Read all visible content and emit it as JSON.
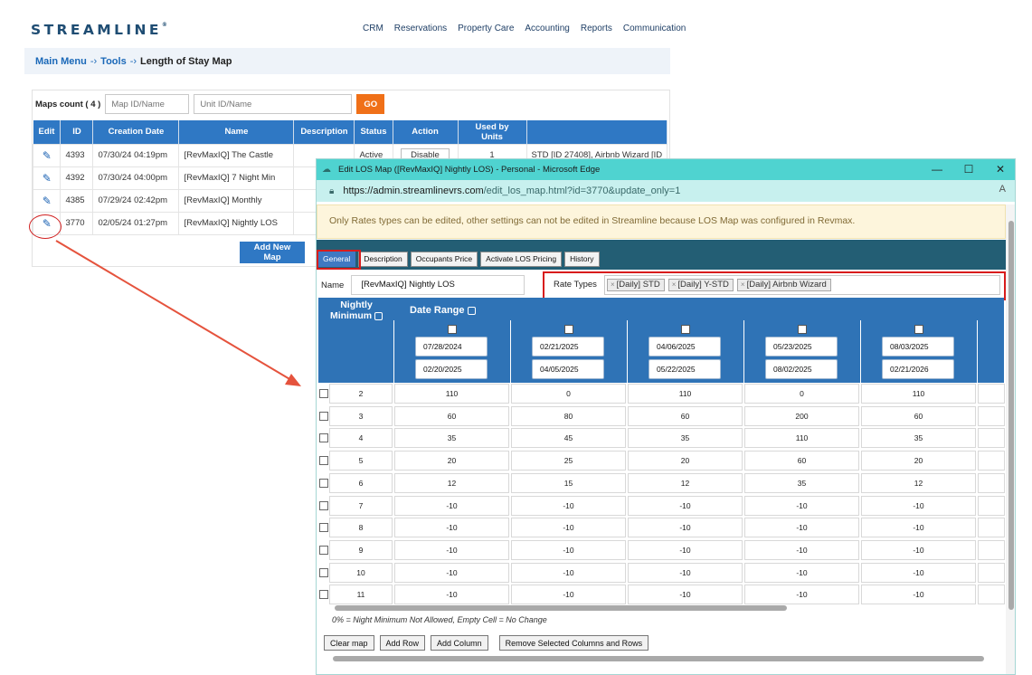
{
  "app": {
    "logo": "STREAMLINE",
    "logo_mark": "®",
    "nav": [
      "CRM",
      "Reservations",
      "Property Care",
      "Accounting",
      "Reports",
      "Communication"
    ],
    "breadcrumb": {
      "main": "Main Menu",
      "tools": "Tools",
      "current": "Length of Stay Map",
      "sep": "-›"
    },
    "maps_count_label": "Maps count ( 4 )",
    "map_id_placeholder": "Map ID/Name",
    "unit_id_placeholder": "Unit ID/Name",
    "go_label": "GO",
    "table": {
      "headers": [
        "Edit",
        "ID",
        "Creation Date",
        "Name",
        "Description",
        "Status",
        "Action",
        "Used by Units",
        ""
      ],
      "rows": [
        {
          "id": "4393",
          "date": "07/30/24 04:19pm",
          "name": "[RevMaxIQ] The Castle",
          "status": "Active",
          "action": "Disable",
          "used": "1",
          "units": "STD [ID 27408], Airbnb Wizard [ID"
        },
        {
          "id": "4392",
          "date": "07/30/24 04:00pm",
          "name": "[RevMaxIQ] 7 Night Min",
          "status": "",
          "action": "",
          "used": "",
          "units": ""
        },
        {
          "id": "4385",
          "date": "07/29/24 02:42pm",
          "name": "[RevMaxIQ] Monthly",
          "status": "",
          "action": "",
          "used": "",
          "units": ""
        },
        {
          "id": "3770",
          "date": "02/05/24 01:27pm",
          "name": "[RevMaxIQ] Nightly LOS",
          "status": "",
          "action": "",
          "used": "",
          "units": ""
        }
      ]
    },
    "add_new_map_label": "Add New Map"
  },
  "popup": {
    "window_title": "Edit LOS Map ([RevMaxIQ] Nightly LOS) - Personal - Microsoft Edge",
    "url_host": "https://admin.streamlinevrs.com",
    "url_path": "/edit_los_map.html?id=3770&update_only=1",
    "notice": "Only Rates types can be edited, other settings can not be edited in Streamline because LOS Map was configured in Revmax.",
    "tabs": [
      "General",
      "Description",
      "Occupants Price",
      "Activate LOS Pricing",
      "History"
    ],
    "active_tab": "General",
    "name_label": "Name",
    "name_value": "[RevMaxIQ] Nightly LOS",
    "rate_types_label": "Rate Types",
    "rate_types": [
      "[Daily] STD",
      "[Daily] Y-STD",
      "[Daily] Airbnb Wizard"
    ],
    "nightly_minimum_label": "Nightly Minimum",
    "date_range_label": "Date Range",
    "date_columns": [
      {
        "from": "07/28/2024",
        "to": "02/20/2025"
      },
      {
        "from": "02/21/2025",
        "to": "04/05/2025"
      },
      {
        "from": "04/06/2025",
        "to": "05/22/2025"
      },
      {
        "from": "05/23/2025",
        "to": "08/02/2025"
      },
      {
        "from": "08/03/2025",
        "to": "02/21/2026"
      }
    ],
    "rows": [
      {
        "nights": "2",
        "values": [
          "110",
          "0",
          "110",
          "0",
          "110"
        ]
      },
      {
        "nights": "3",
        "values": [
          "60",
          "80",
          "60",
          "200",
          "60"
        ]
      },
      {
        "nights": "4",
        "values": [
          "35",
          "45",
          "35",
          "110",
          "35"
        ]
      },
      {
        "nights": "5",
        "values": [
          "20",
          "25",
          "20",
          "60",
          "20"
        ]
      },
      {
        "nights": "6",
        "values": [
          "12",
          "15",
          "12",
          "35",
          "12"
        ]
      },
      {
        "nights": "7",
        "values": [
          "-10",
          "-10",
          "-10",
          "-10",
          "-10"
        ]
      },
      {
        "nights": "8",
        "values": [
          "-10",
          "-10",
          "-10",
          "-10",
          "-10"
        ]
      },
      {
        "nights": "9",
        "values": [
          "-10",
          "-10",
          "-10",
          "-10",
          "-10"
        ]
      },
      {
        "nights": "10",
        "values": [
          "-10",
          "-10",
          "-10",
          "-10",
          "-10"
        ]
      },
      {
        "nights": "11",
        "values": [
          "-10",
          "-10",
          "-10",
          "-10",
          "-10"
        ]
      }
    ],
    "legend": "0% = Night Minimum Not Allowed, Empty Cell = No Change",
    "buttons": {
      "clear": "Clear map",
      "add_row": "Add Row",
      "add_column": "Add Column",
      "remove": "Remove Selected Columns and Rows"
    }
  },
  "colors": {
    "brand": "#1f4d73",
    "primary_blue": "#2f78c4",
    "go_orange": "#f07018",
    "highlight_red": "#d81c1c",
    "titlebar": "#4fd3d0",
    "band_teal": "#235e74"
  }
}
